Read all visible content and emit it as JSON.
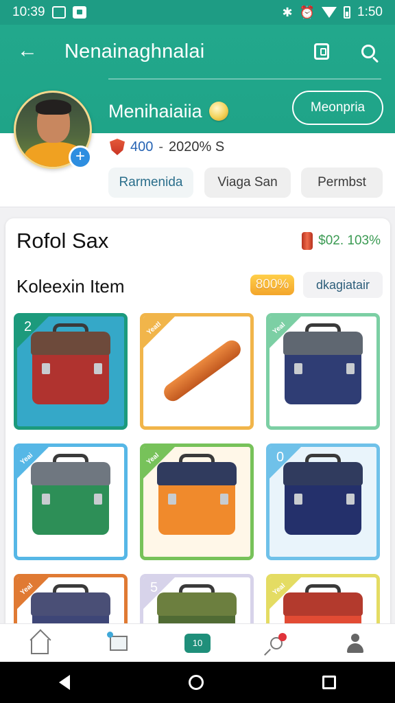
{
  "status_bar": {
    "time": "10:39",
    "time_right": "1:50",
    "icons": [
      "notification-icon",
      "photo-icon",
      "bluetooth-icon",
      "alarm-icon",
      "wifi-icon",
      "battery-icon"
    ]
  },
  "header": {
    "title": "Nenainaghnalai",
    "back_icon": "arrow-left-icon",
    "actions": [
      "tablet-icon",
      "search-icon"
    ]
  },
  "profile": {
    "name": "Menihaiaiia",
    "member_button": "Meonpria",
    "points": "400",
    "separator": "-",
    "stat_text": "2020% S",
    "chips": [
      "Rarmenida",
      "Viaga San",
      "Permbst"
    ]
  },
  "card": {
    "title": "Rofol Sax",
    "balance": "$02. 103%",
    "collection_title": "Koleexin Item",
    "percent_badge": "800%",
    "filter_label": "dkagiatair"
  },
  "tiles": [
    {
      "corner": "2",
      "color": "#1c9a7c",
      "bg": "#35a8c8"
    },
    {
      "corner": "Yeatl",
      "color": "#f1b54a",
      "bg": "#ffffff"
    },
    {
      "corner": "Yeal",
      "color": "#7ccfa4",
      "bg": "#ffffff"
    },
    {
      "corner": "Yeai",
      "color": "#56b7e6",
      "bg": "#ffffff"
    },
    {
      "corner": "Yeal",
      "color": "#77c25a",
      "bg": "#fff7e8"
    },
    {
      "corner": "0",
      "color": "#6fc1e9",
      "bg": "#e9f4fb"
    },
    {
      "corner": "Yeal",
      "color": "#e07a33",
      "bg": "#ffffff"
    },
    {
      "corner": "5",
      "color": "#d7d3ea",
      "bg": "#ffffff"
    },
    {
      "corner": "Yeal",
      "color": "#e4dc63",
      "bg": "#ffffff"
    }
  ],
  "bottom_nav": [
    "home-icon",
    "box-icon",
    "collection-icon",
    "location-icon",
    "profile-icon"
  ],
  "bottom_nav_active_label": "10",
  "colors": {
    "primary": "#1fa488",
    "accent_blue": "#2e8ee0",
    "positive": "#3a9a52"
  }
}
